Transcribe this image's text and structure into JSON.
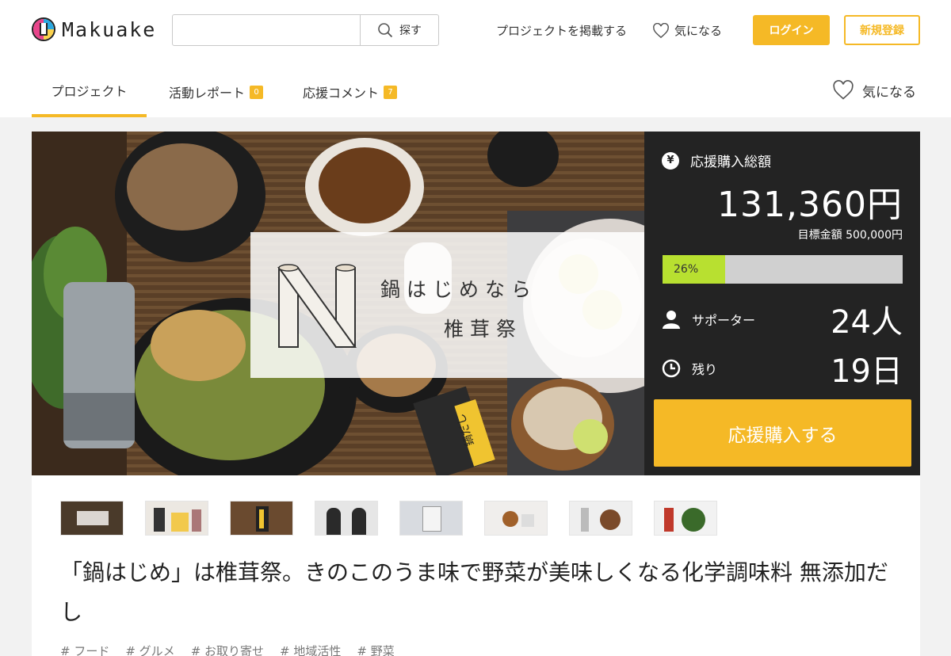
{
  "header": {
    "logo_text": "Makuake",
    "search_placeholder": "",
    "search_button": "探す",
    "post_project": "プロジェクトを掲載する",
    "favorite": "気になる",
    "login": "ログイン",
    "signup": "新規登録"
  },
  "tabs": [
    {
      "label": "プロジェクト",
      "badge": ""
    },
    {
      "label": "活動レポート",
      "badge": "0"
    },
    {
      "label": "応援コメント",
      "badge": "7"
    }
  ],
  "tab_favorite": "気になる",
  "hero": {
    "overlay_line1": "鍋はじめなら",
    "overlay_line2": "椎茸祭",
    "package_label": "鍋だし"
  },
  "funding": {
    "total_label": "応援購入総額",
    "currency_icon": "¥",
    "amount": "131,360円",
    "goal": "目標金額 500,000円",
    "percent_text": "26%",
    "percent_value": 0.26,
    "supporters_label": "サポーター",
    "supporters_value": "24人",
    "remaining_label": "残り",
    "remaining_value": "19日",
    "cta": "応援購入する"
  },
  "thumbnails_count": 8,
  "title": "「鍋はじめ」は椎茸祭。きのこのうま味で野菜が美味しくなる化学調味料 無添加だし",
  "tags": [
    "# フード",
    "# グルメ",
    "# お取り寄せ",
    "# 地域活性",
    "# 野菜"
  ],
  "colors": {
    "accent": "#f5b926",
    "progress": "#b8e030",
    "panel": "#232323"
  }
}
